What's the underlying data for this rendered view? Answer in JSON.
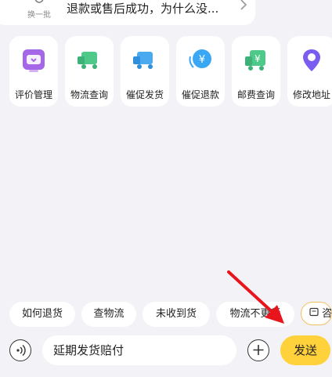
{
  "top_card": {
    "swap_label": "换一批",
    "question": "退款或售后成功，为什么没...",
    "swap_icon": "refresh-icon",
    "chevron_icon": "chevron-right-icon"
  },
  "actions": [
    {
      "label": "评价管理",
      "icon": "review-icon",
      "color": "#a566e8"
    },
    {
      "label": "物流查询",
      "icon": "truck-icon",
      "color": "#4fc98a"
    },
    {
      "label": "催促发货",
      "icon": "truck-fast-icon",
      "color": "#4ba9f0"
    },
    {
      "label": "催促退款",
      "icon": "yen-coin-icon",
      "color": "#3aa7f5"
    },
    {
      "label": "邮费查询",
      "icon": "postage-truck-icon",
      "color": "#4fc98a"
    },
    {
      "label": "修改地址",
      "icon": "location-pin-icon",
      "color": "#7b5cf0"
    }
  ],
  "chips": [
    {
      "label": "如何退货"
    },
    {
      "label": "查物流"
    },
    {
      "label": "未收到货"
    },
    {
      "label": "物流不更新"
    },
    {
      "label": "咨"
    }
  ],
  "input": {
    "value": "延期发货赔付",
    "send_label": "发送",
    "voice_icon": "voice-icon",
    "plus_icon": "plus-icon"
  },
  "colors": {
    "background": "#f3f3f7",
    "accent": "#ffd23c",
    "arrow": "#e8161c"
  }
}
